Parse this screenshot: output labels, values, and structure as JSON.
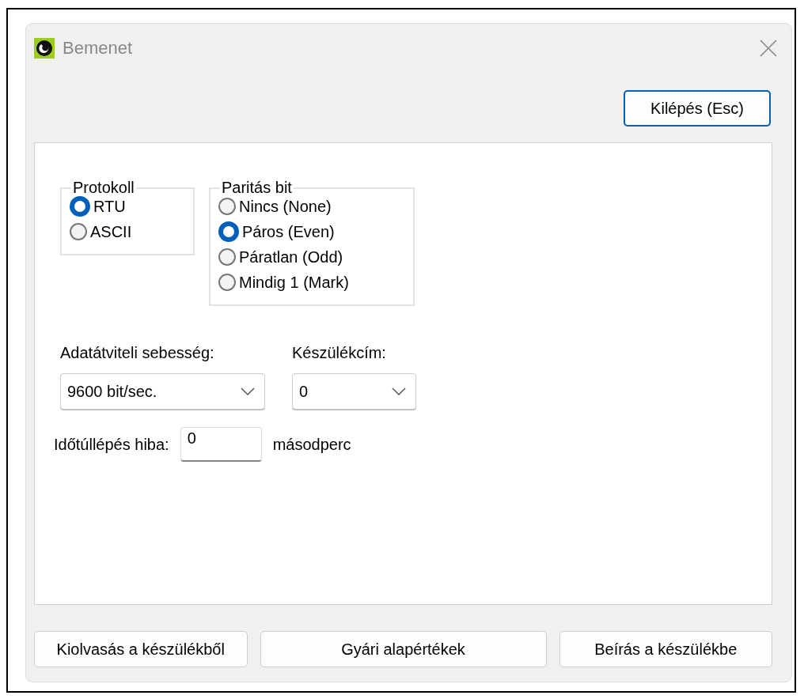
{
  "window": {
    "title": "Bemenet"
  },
  "exit_button": "Kilépés (Esc)",
  "protocol": {
    "title": "Protokoll",
    "options": [
      {
        "label": "RTU",
        "selected": true
      },
      {
        "label": "ASCII",
        "selected": false
      }
    ]
  },
  "parity": {
    "title": "Paritás bit",
    "options": [
      {
        "label": "Nincs (None)",
        "selected": false
      },
      {
        "label": "Páros (Even)",
        "selected": true
      },
      {
        "label": "Páratlan (Odd)",
        "selected": false
      },
      {
        "label": "Mindig 1 (Mark)",
        "selected": false
      }
    ]
  },
  "baud": {
    "label": "Adatátviteli sebesség:",
    "value": "9600 bit/sec."
  },
  "address": {
    "label": "Készülékcím:",
    "value": "0"
  },
  "timeout": {
    "label": "Időtúllépés hiba:",
    "value": "0",
    "unit": "másodperc"
  },
  "buttons": [
    "Kiolvasás a készülékből",
    "Gyári alapértékek",
    "Beírás a készülékbe"
  ]
}
